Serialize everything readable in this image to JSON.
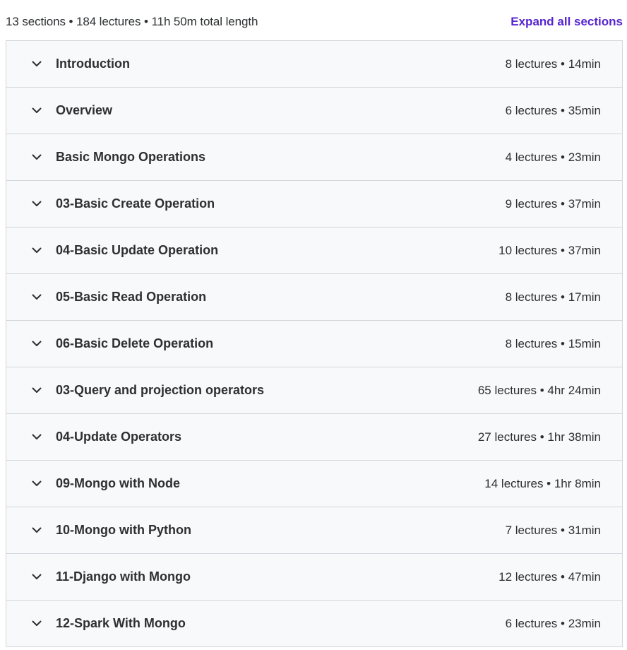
{
  "header": {
    "summary": "13 sections • 184 lectures • 11h 50m total length",
    "expand_all_label": "Expand all sections"
  },
  "colors": {
    "accent": "#5624d0",
    "row_bg": "#f7f9fa",
    "border": "#d1d7dc"
  },
  "sections": [
    {
      "title": "Introduction",
      "meta": "8 lectures • 14min",
      "icon": "chevron-down-icon"
    },
    {
      "title": "Overview",
      "meta": "6 lectures • 35min",
      "icon": "chevron-down-icon"
    },
    {
      "title": "Basic Mongo Operations",
      "meta": "4 lectures • 23min",
      "icon": "chevron-down-icon"
    },
    {
      "title": "03-Basic Create Operation",
      "meta": "9 lectures • 37min",
      "icon": "chevron-down-icon"
    },
    {
      "title": "04-Basic Update Operation",
      "meta": "10 lectures • 37min",
      "icon": "chevron-down-icon"
    },
    {
      "title": "05-Basic Read Operation",
      "meta": "8 lectures • 17min",
      "icon": "chevron-down-icon"
    },
    {
      "title": "06-Basic Delete Operation",
      "meta": "8 lectures • 15min",
      "icon": "chevron-down-icon"
    },
    {
      "title": "03-Query and projection operators",
      "meta": "65 lectures • 4hr 24min",
      "icon": "chevron-down-icon"
    },
    {
      "title": "04-Update Operators",
      "meta": "27 lectures • 1hr 38min",
      "icon": "chevron-down-icon"
    },
    {
      "title": "09-Mongo with Node",
      "meta": "14 lectures • 1hr 8min",
      "icon": "chevron-down-icon"
    },
    {
      "title": "10-Mongo with Python",
      "meta": "7 lectures • 31min",
      "icon": "chevron-down-icon"
    },
    {
      "title": "11-Django with Mongo",
      "meta": "12 lectures • 47min",
      "icon": "chevron-down-icon"
    },
    {
      "title": "12-Spark With Mongo",
      "meta": "6 lectures • 23min",
      "icon": "chevron-down-icon"
    }
  ]
}
